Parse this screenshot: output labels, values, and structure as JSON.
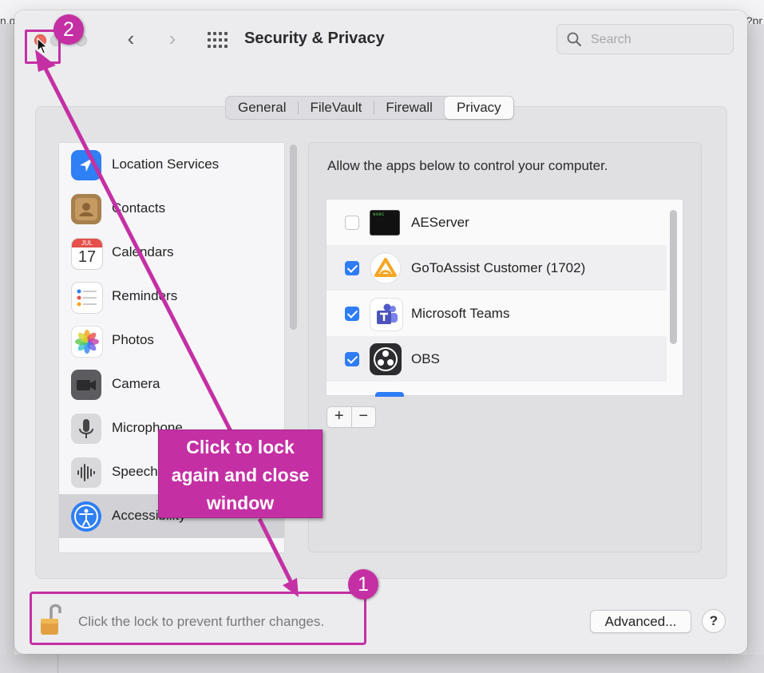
{
  "background": {
    "left_fragment": "n.g",
    "right_fragment": "?pr"
  },
  "window": {
    "title": "Security & Privacy",
    "search": {
      "placeholder": "Search",
      "value": ""
    },
    "nav": {
      "back": "‹",
      "forward": "›"
    }
  },
  "tabs": [
    {
      "label": "General",
      "active": false
    },
    {
      "label": "FileVault",
      "active": false
    },
    {
      "label": "Firewall",
      "active": false
    },
    {
      "label": "Privacy",
      "active": true
    }
  ],
  "sidebar": {
    "items": [
      {
        "label": "Location Services",
        "icon": "location-arrow-icon",
        "selected": false
      },
      {
        "label": "Contacts",
        "icon": "contacts-book-icon",
        "selected": false
      },
      {
        "label": "Calendars",
        "icon": "calendar-icon",
        "selected": false,
        "icon_text": {
          "month": "JUL",
          "day": "17"
        }
      },
      {
        "label": "Reminders",
        "icon": "reminders-list-icon",
        "selected": false
      },
      {
        "label": "Photos",
        "icon": "photos-flower-icon",
        "selected": false
      },
      {
        "label": "Camera",
        "icon": "camera-icon",
        "selected": false
      },
      {
        "label": "Microphone",
        "icon": "microphone-icon",
        "selected": false
      },
      {
        "label": "Speech Recognition",
        "icon": "speech-waveform-icon",
        "selected": false
      },
      {
        "label": "Accessibility",
        "icon": "accessibility-person-icon",
        "selected": true
      }
    ]
  },
  "panel": {
    "description": "Allow the apps below to control your computer.",
    "apps": [
      {
        "name": "AEServer",
        "checked": false,
        "icon": "terminal-icon",
        "icon_text": "exec"
      },
      {
        "name": "GoToAssist Customer (1702)",
        "checked": true,
        "icon": "gotoassist-icon"
      },
      {
        "name": "Microsoft Teams",
        "checked": true,
        "icon": "teams-icon"
      },
      {
        "name": "OBS",
        "checked": true,
        "icon": "obs-icon"
      }
    ],
    "add_label": "+",
    "remove_label": "−"
  },
  "footer": {
    "lock_text": "Click the lock to prevent further changes.",
    "advanced_label": "Advanced...",
    "help_label": "?"
  },
  "annotations": {
    "callout_lines": [
      "Click to lock",
      "again and close",
      "window"
    ],
    "step1": "1",
    "step2": "2",
    "color": "#c430a4"
  },
  "colors": {
    "accent": "#2e7cf6",
    "annotation": "#c430a4",
    "close_button": "#ed6a5e"
  }
}
